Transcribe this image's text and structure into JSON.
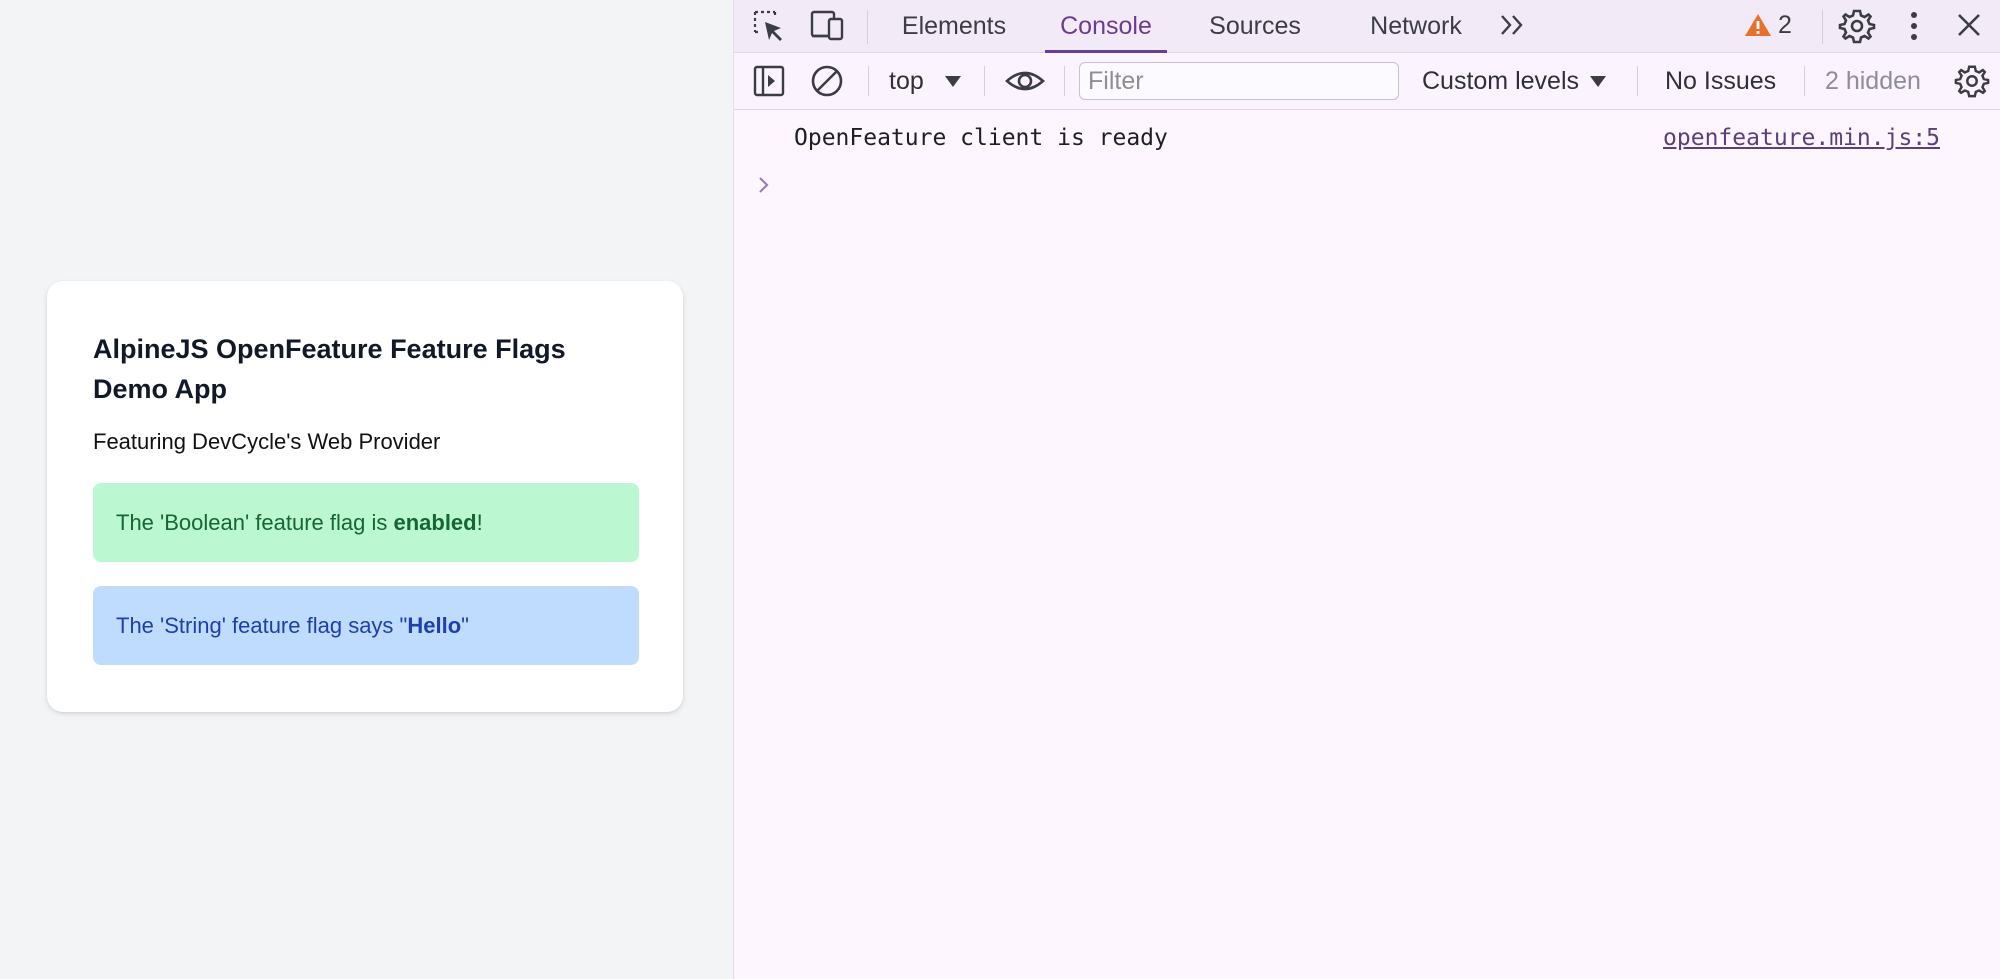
{
  "page": {
    "title": "AlpineJS OpenFeature Feature Flags Demo App",
    "subtitle": "Featuring DevCycle's Web Provider",
    "boolean_alert": {
      "prefix": "The 'Boolean' feature flag is ",
      "value": "enabled",
      "suffix": "!"
    },
    "string_alert": {
      "prefix": "The 'String' feature flag says \"",
      "value": "Hello",
      "suffix": "\""
    }
  },
  "devtools": {
    "tabs": [
      "Elements",
      "Console",
      "Sources",
      "Network"
    ],
    "active_tab": "Console",
    "warning_count": "2",
    "toolbar": {
      "context": "top",
      "filter_placeholder": "Filter",
      "levels": "Custom levels",
      "issues": "No Issues",
      "hidden": "2 hidden"
    },
    "console": {
      "message": "OpenFeature client is ready",
      "source": "openfeature.min.js:5"
    }
  },
  "colors": {
    "accent": "#6a3d8e",
    "warning": "#e8702a",
    "success_bg": "#bbf7d0",
    "info_bg": "#bfdbfe"
  }
}
